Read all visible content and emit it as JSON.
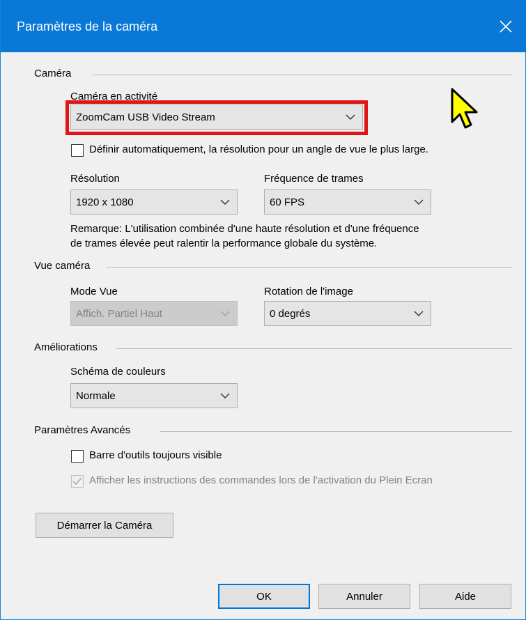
{
  "window": {
    "title": "Paramètres de la caméra",
    "close_glyph": "✕"
  },
  "camera_section": {
    "title": "Caméra",
    "active_camera_label": "Caméra en activité",
    "active_camera_value": "ZoomCam USB Video Stream",
    "auto_checkbox_label": "Définir automatiquement, la résolution pour un angle de vue le plus large.",
    "auto_checked": false,
    "resolution_label": "Résolution",
    "resolution_value": "1920 x 1080",
    "framerate_label": "Fréquence de trames",
    "framerate_value": "60 FPS",
    "note_line1": "Remarque: L'utilisation combinée d'une haute résolution et d'une fréquence",
    "note_line2": "de trames élevée peut ralentir la performance globale du système."
  },
  "view_section": {
    "title": "Vue caméra",
    "mode_label": "Mode Vue",
    "mode_value": "Affich. Partiel Haut",
    "rotation_label": "Rotation de l'image",
    "rotation_value": "0 degrés"
  },
  "improvements_section": {
    "title": "Améliorations",
    "color_scheme_label": "Schéma de couleurs",
    "color_scheme_value": "Normale"
  },
  "advanced_section": {
    "title": "Paramètres Avancés",
    "toolbar_label": "Barre d'outils toujours visible",
    "toolbar_checked": false,
    "instructions_label": "Afficher les instructions des commandes lors de l'activation du Plein Ecran",
    "instructions_checked": true
  },
  "buttons": {
    "start_camera": "Démarrer la Caméra",
    "ok": "OK",
    "cancel": "Annuler",
    "help": "Aide"
  },
  "colors": {
    "titlebar": "#0a78d7",
    "highlight": "#e01515",
    "cursor": "#ffff00"
  },
  "icons": [
    "close-icon",
    "chevron-down-icon",
    "checkmark-icon",
    "mouse-cursor-icon"
  ]
}
